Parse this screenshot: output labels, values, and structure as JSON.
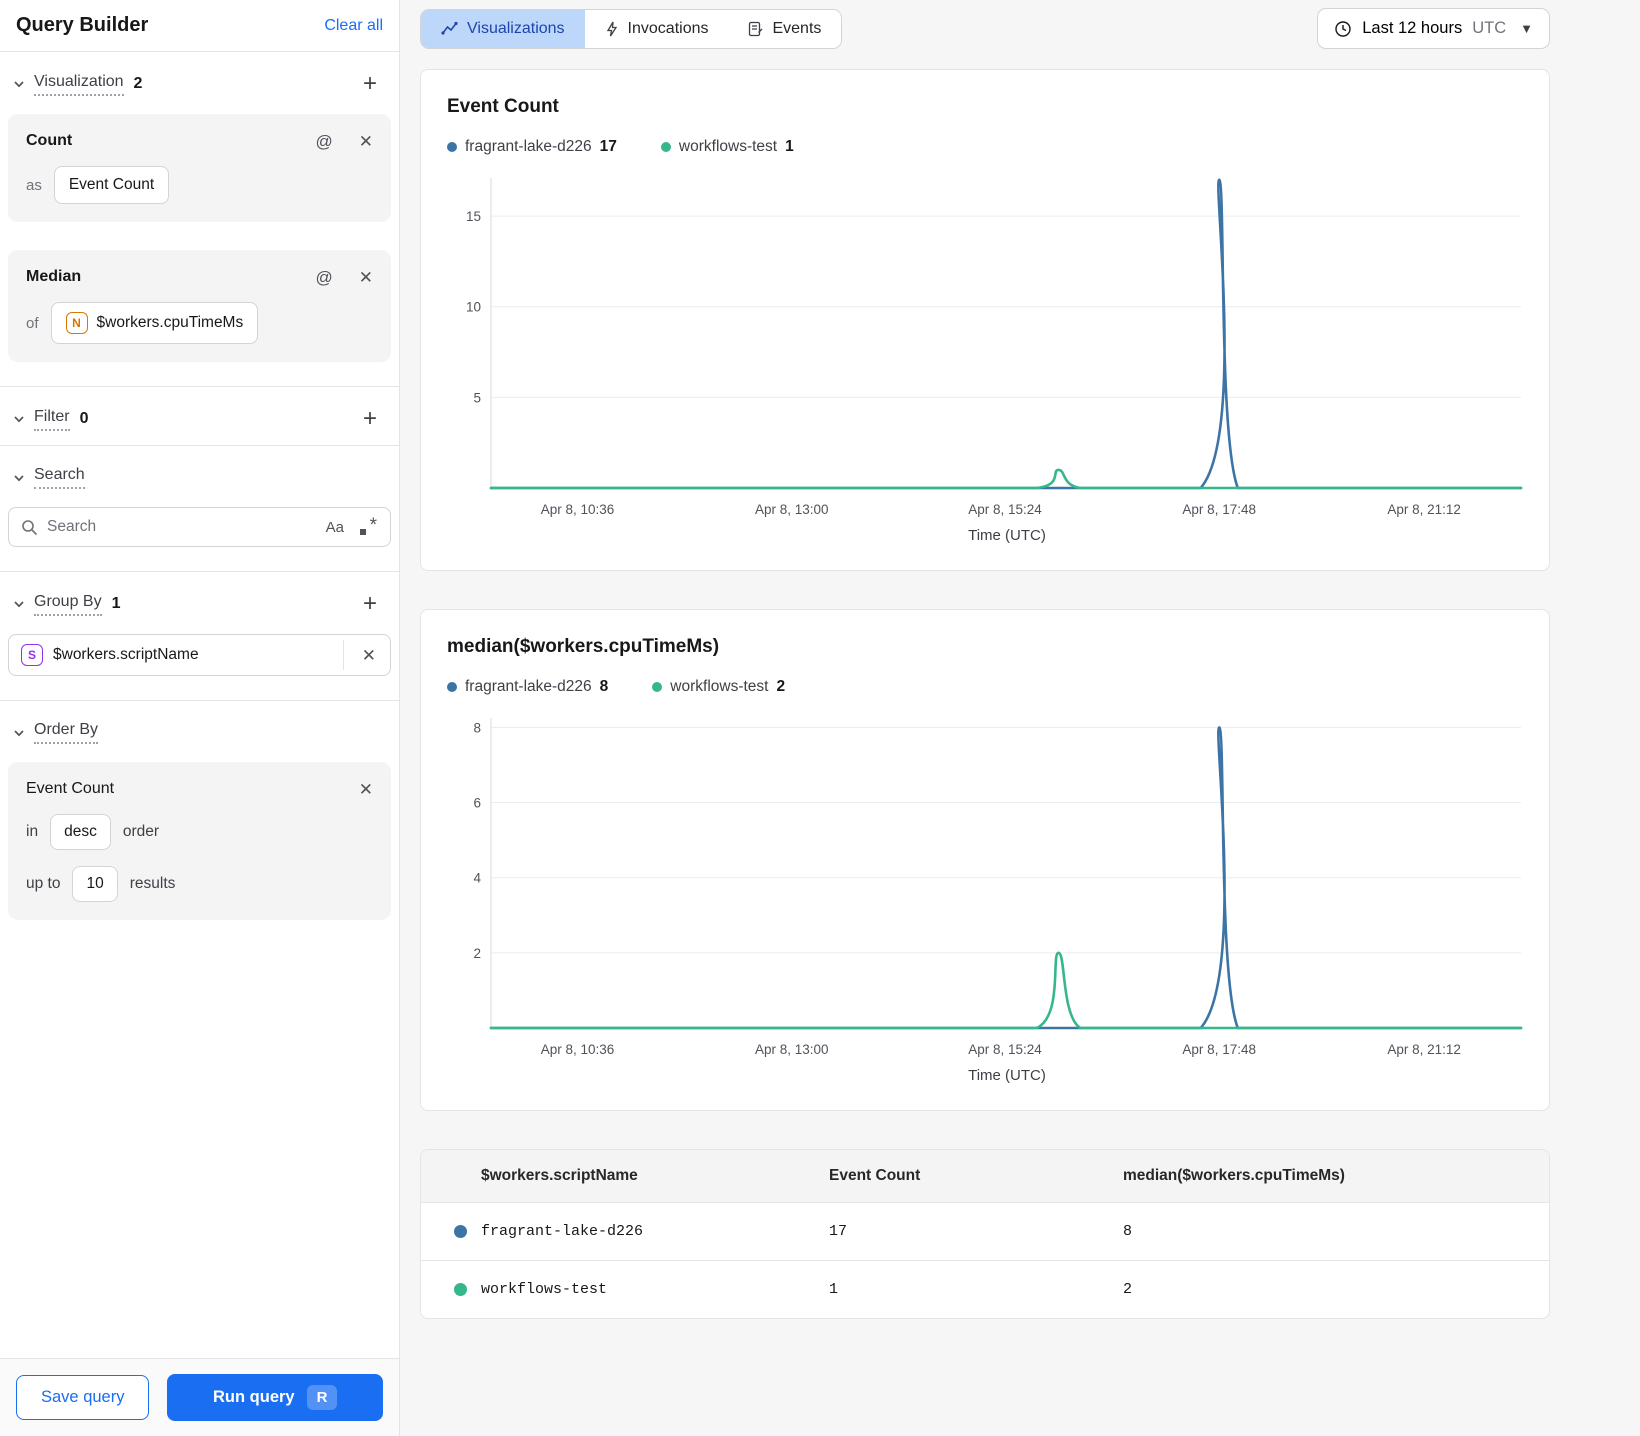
{
  "colors": {
    "accent": "#1a6ef2",
    "tab_active_bg": "#bcd7fa",
    "tab_active_text": "#1e44ad",
    "series_blue": "#3d74a6",
    "series_green": "#35b789",
    "icon_orange": "#d97706",
    "icon_purple": "#9333ea",
    "grid": "#ececec",
    "axis": "#d9d9dc",
    "tick_text": "#52525b"
  },
  "sidebar": {
    "title": "Query Builder",
    "clear_all": "Clear all",
    "visualization": {
      "label": "Visualization",
      "count": "2",
      "cards": [
        {
          "title": "Count",
          "prefix": "as",
          "value": "Event Count"
        },
        {
          "title": "Median",
          "prefix": "of",
          "value": "$workers.cpuTimeMs",
          "badge": "N"
        }
      ]
    },
    "filter": {
      "label": "Filter",
      "count": "0"
    },
    "search": {
      "label": "Search",
      "placeholder": "Search",
      "case_icon": "Aa"
    },
    "group_by": {
      "label": "Group By",
      "count": "1",
      "field": "$workers.scriptName",
      "badge": "S"
    },
    "order_by": {
      "label": "Order By",
      "field": "Event Count",
      "in_label": "in",
      "direction": "desc",
      "order_label": "order",
      "upto_label": "up to",
      "limit": "10",
      "results_label": "results"
    },
    "footer": {
      "save_label": "Save query",
      "run_label": "Run query",
      "run_shortcut": "R"
    }
  },
  "topbar": {
    "tabs": [
      {
        "label": "Visualizations",
        "active": true
      },
      {
        "label": "Invocations",
        "active": false
      },
      {
        "label": "Events",
        "active": false
      }
    ],
    "time_range": {
      "label": "Last 12 hours",
      "zone": "UTC"
    }
  },
  "chart_data": [
    {
      "type": "line",
      "title": "Event Count",
      "xlabel": "Time (UTC)",
      "ylabel": "",
      "ylim": [
        0,
        17.1
      ],
      "yticks": [
        5,
        10,
        15
      ],
      "grid": true,
      "legend_position": "top",
      "x_ticks": [
        {
          "label": "Apr 8, 10:36",
          "frac": 0.084
        },
        {
          "label": "Apr 8, 13:00",
          "frac": 0.292
        },
        {
          "label": "Apr 8, 15:24",
          "frac": 0.499
        },
        {
          "label": "Apr 8, 17:48",
          "frac": 0.707
        },
        {
          "label": "Apr 8, 21:12",
          "frac": 0.906
        }
      ],
      "legend": [
        {
          "name": "fragrant-lake-d226",
          "value": "17",
          "color_key": "series_blue"
        },
        {
          "name": "workflows-test",
          "value": "1",
          "color_key": "series_green"
        }
      ],
      "series": [
        {
          "name": "fragrant-lake-d226",
          "color_key": "series_blue",
          "points": [
            [
              0,
              0
            ],
            [
              0.45,
              0
            ],
            [
              0.689,
              0
            ],
            [
              0.707,
              17
            ],
            [
              0.725,
              0
            ],
            [
              0.82,
              0
            ],
            [
              1,
              0
            ]
          ]
        },
        {
          "name": "workflows-test",
          "color_key": "series_green",
          "points": [
            [
              0,
              0
            ],
            [
              0.4,
              0
            ],
            [
              0.53,
              0
            ],
            [
              0.551,
              1
            ],
            [
              0.572,
              0
            ],
            [
              0.66,
              0
            ],
            [
              1,
              0
            ]
          ]
        }
      ]
    },
    {
      "type": "line",
      "title": "median($workers.cpuTimeMs)",
      "xlabel": "Time (UTC)",
      "ylabel": "",
      "ylim": [
        0,
        8.25
      ],
      "yticks": [
        2,
        4,
        6,
        8
      ],
      "grid": true,
      "legend_position": "top",
      "x_ticks": [
        {
          "label": "Apr 8, 10:36",
          "frac": 0.084
        },
        {
          "label": "Apr 8, 13:00",
          "frac": 0.292
        },
        {
          "label": "Apr 8, 15:24",
          "frac": 0.499
        },
        {
          "label": "Apr 8, 17:48",
          "frac": 0.707
        },
        {
          "label": "Apr 8, 21:12",
          "frac": 0.906
        }
      ],
      "legend": [
        {
          "name": "fragrant-lake-d226",
          "value": "8",
          "color_key": "series_blue"
        },
        {
          "name": "workflows-test",
          "value": "2",
          "color_key": "series_green"
        }
      ],
      "series": [
        {
          "name": "fragrant-lake-d226",
          "color_key": "series_blue",
          "points": [
            [
              0,
              0
            ],
            [
              0.45,
              0
            ],
            [
              0.689,
              0
            ],
            [
              0.707,
              8
            ],
            [
              0.725,
              0
            ],
            [
              0.82,
              0
            ],
            [
              1,
              0
            ]
          ]
        },
        {
          "name": "workflows-test",
          "color_key": "series_green",
          "points": [
            [
              0,
              0
            ],
            [
              0.4,
              0
            ],
            [
              0.53,
              0
            ],
            [
              0.551,
              2
            ],
            [
              0.572,
              0
            ],
            [
              0.66,
              0
            ],
            [
              1,
              0
            ]
          ]
        }
      ]
    }
  ],
  "table": {
    "headers": [
      "$workers.scriptName",
      "Event Count",
      "median($workers.cpuTimeMs)"
    ],
    "rows": [
      {
        "name": "fragrant-lake-d226",
        "event_count": "17",
        "median": "8",
        "color_key": "series_blue"
      },
      {
        "name": "workflows-test",
        "event_count": "1",
        "median": "2",
        "color_key": "series_green"
      }
    ]
  }
}
